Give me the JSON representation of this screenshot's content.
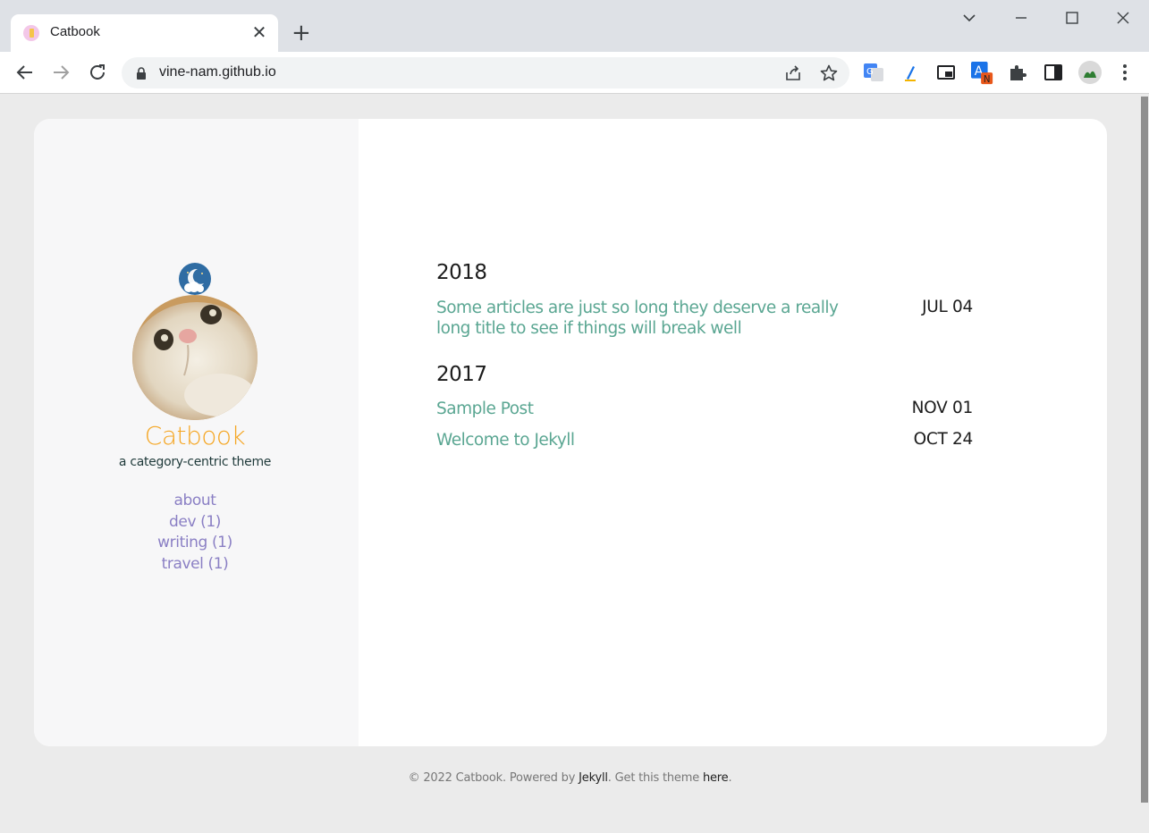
{
  "browser": {
    "tab_title": "Catbook",
    "tab_close": "✕",
    "new_tab": "+",
    "url": "vine-nam.github.io"
  },
  "site": {
    "title": "Catbook",
    "subtitle": "a category-centric theme",
    "nav": [
      {
        "label": "about"
      },
      {
        "label": "dev (1)"
      },
      {
        "label": "writing (1)"
      },
      {
        "label": "travel (1)"
      }
    ]
  },
  "archive": {
    "years": [
      {
        "year": "2018",
        "posts": [
          {
            "title": "Some articles are just so long they deserve a really long title to see if things will break well",
            "date": "JUL 04"
          }
        ]
      },
      {
        "year": "2017",
        "posts": [
          {
            "title": "Sample Post",
            "date": "NOV 01"
          },
          {
            "title": "Welcome to Jekyll",
            "date": "OCT 24"
          }
        ]
      }
    ]
  },
  "footer": {
    "prefix": "© 2022 Catbook. Powered by ",
    "jekyll": "Jekyll",
    "middle": ". Get this theme ",
    "here": "here",
    "suffix": "."
  },
  "colors": {
    "title": "#f5a623",
    "link": "#5aa692",
    "nav": "#8a7fc4"
  }
}
